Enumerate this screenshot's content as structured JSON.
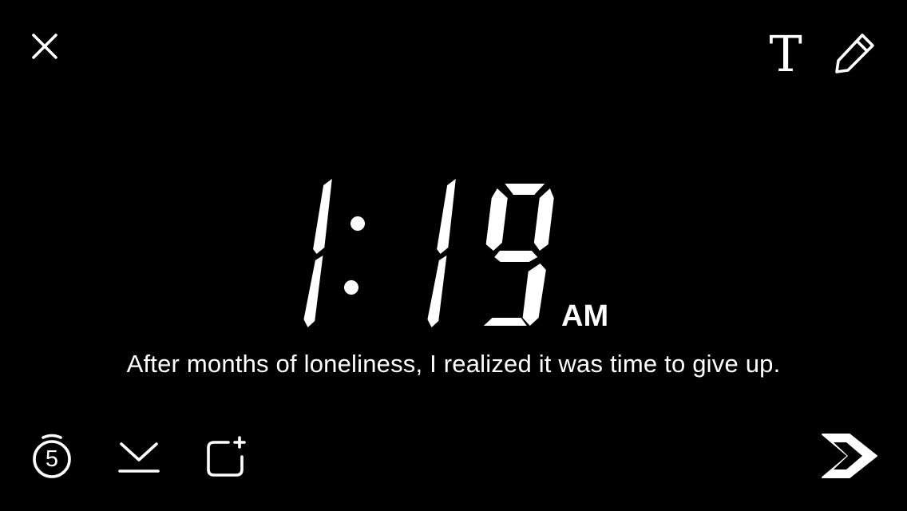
{
  "toolbar": {
    "text_tool_label": "T"
  },
  "clock": {
    "hours": "1",
    "minutes": "19",
    "period": "AM"
  },
  "caption": {
    "text": "After months of loneliness, I realized it was time to give up."
  },
  "bottom_bar": {
    "timer_value": "5"
  },
  "colors": {
    "background": "#000000",
    "foreground": "#ffffff"
  }
}
